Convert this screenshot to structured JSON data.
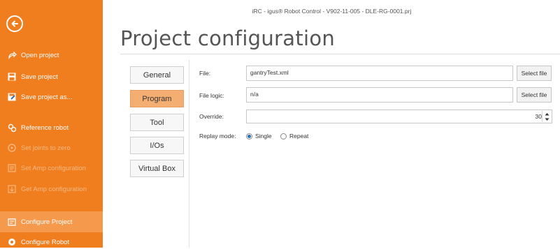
{
  "window_title": "iRC - igus® Robot Control - V902-11-005 - DLE-RG-0001.prj",
  "page_title": "Project configuration",
  "sidebar": {
    "back_icon": "arrow-left-circle-icon",
    "items": [
      {
        "label": "Open project",
        "icon": "open-folder-icon",
        "enabled": true
      },
      {
        "label": "Save project",
        "icon": "floppy-disk-icon",
        "enabled": true
      },
      {
        "label": "Save project as...",
        "icon": "save-as-icon",
        "enabled": true
      },
      {
        "label": "Reference robot",
        "icon": "reference-gears-icon",
        "enabled": true
      },
      {
        "label": "Set joints to zero",
        "icon": "joint-zero-icon",
        "enabled": false
      },
      {
        "label": "Set Amp configuration",
        "icon": "amp-set-icon",
        "enabled": false
      },
      {
        "label": "Get Amp configuration",
        "icon": "amp-get-icon",
        "enabled": false
      },
      {
        "label": "Configure Project",
        "icon": "project-config-icon",
        "enabled": true,
        "active": true
      },
      {
        "label": "Configure Robot",
        "icon": "robot-gear-icon",
        "enabled": true
      }
    ]
  },
  "tabs": [
    {
      "label": "General",
      "active": false
    },
    {
      "label": "Program",
      "active": true
    },
    {
      "label": "Tool",
      "active": false
    },
    {
      "label": "I/Os",
      "active": false
    },
    {
      "label": "Virtual Box",
      "active": false
    }
  ],
  "form": {
    "file_label": "File:",
    "file_value": "gantryTest.xml",
    "file_button": "Select file",
    "logic_label": "File logic:",
    "logic_value": "n/a",
    "logic_button": "Select file",
    "override_label": "Override:",
    "override_value": "30",
    "replay_label": "Replay mode:",
    "replay_options": [
      {
        "label": "Single",
        "selected": true
      },
      {
        "label": "Repeat",
        "selected": false
      }
    ]
  },
  "colors": {
    "accent": "#f07d1e",
    "active_tab": "#f5ae72"
  }
}
